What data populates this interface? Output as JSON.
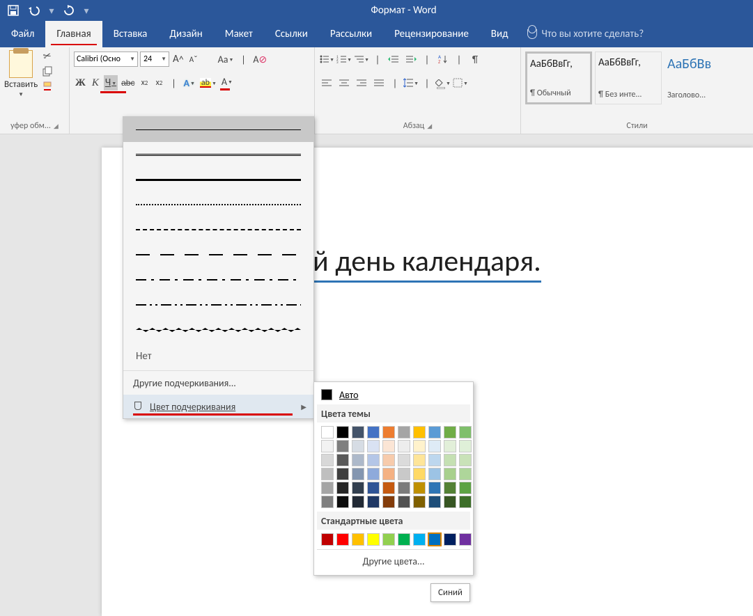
{
  "title": "Формат - Word",
  "tabs": [
    "Файл",
    "Главная",
    "Вставка",
    "Дизайн",
    "Макет",
    "Ссылки",
    "Рассылки",
    "Рецензирование",
    "Вид"
  ],
  "active_tab": 1,
  "tellme": "Что вы хотите сделать?",
  "clipboard": {
    "paste": "Вставить",
    "group": "уфер обм..."
  },
  "font": {
    "name": "Calibri (Осно",
    "size": "24",
    "buttons": {
      "bold": "Ж",
      "italic": "К",
      "underline": "Ч",
      "strike": "abc",
      "sub": "x",
      "sup": "x",
      "texteffect": "A",
      "highlight": "ab",
      "color": "A",
      "grow": "A",
      "shrink": "A",
      "case": "Aa",
      "clear": "A"
    }
  },
  "paragraph": {
    "group": "Абзац"
  },
  "styles": {
    "group": "Стили",
    "items": [
      {
        "sample": "АаБбВвГг,",
        "name": "¶ Обычный",
        "selected": true,
        "blue": false
      },
      {
        "sample": "АаБбВвГг,",
        "name": "¶ Без инте...",
        "selected": false,
        "blue": false
      },
      {
        "sample": "АаБбВв",
        "name": "Заголово...",
        "selected": false,
        "blue": true
      }
    ]
  },
  "docline": "й день календаря.",
  "underline_menu": {
    "none": "Нет",
    "more": "Другие подчеркивания...",
    "color": "Цвет подчеркивания"
  },
  "color_menu": {
    "auto": "Авто",
    "theme": "Цвета темы",
    "standard": "Стандартные цвета",
    "more": "Другие цвета..."
  },
  "theme_rows": [
    [
      "#ffffff",
      "#000000",
      "#44546a",
      "#4472c4",
      "#ed7d31",
      "#a5a5a5",
      "#ffc000",
      "#5b9bd5",
      "#70ad47",
      "#7fbf6b"
    ],
    [
      "#f2f2f2",
      "#7f7f7f",
      "#d6dce4",
      "#d9e2f3",
      "#fbe5d5",
      "#ededed",
      "#fff2cc",
      "#deebf6",
      "#e2efd9",
      "#dff0d8"
    ],
    [
      "#d8d8d8",
      "#595959",
      "#adb9ca",
      "#b4c6e7",
      "#f7cbac",
      "#dbdbdb",
      "#fee599",
      "#bdd7ee",
      "#c5e0b3",
      "#c9e2b8"
    ],
    [
      "#bfbfbf",
      "#3f3f3f",
      "#8496b0",
      "#8eaadb",
      "#f4b183",
      "#c9c9c9",
      "#ffd965",
      "#9cc3e5",
      "#a8d08d",
      "#aed69a"
    ],
    [
      "#a5a5a5",
      "#262626",
      "#323f4f",
      "#2f5496",
      "#c55a11",
      "#7b7b7b",
      "#bf9000",
      "#2e75b5",
      "#538135",
      "#5da344"
    ],
    [
      "#7f7f7f",
      "#0c0c0c",
      "#222a35",
      "#1f3864",
      "#833c0b",
      "#525252",
      "#7f6000",
      "#1e4e79",
      "#375623",
      "#3d6e29"
    ]
  ],
  "standard_colors": [
    "#c00000",
    "#ff0000",
    "#ffc000",
    "#ffff00",
    "#92d050",
    "#00b050",
    "#00b0f0",
    "#0070c0",
    "#002060",
    "#7030a0"
  ],
  "selected_color": "#0070c0",
  "tooltip": "Синий"
}
